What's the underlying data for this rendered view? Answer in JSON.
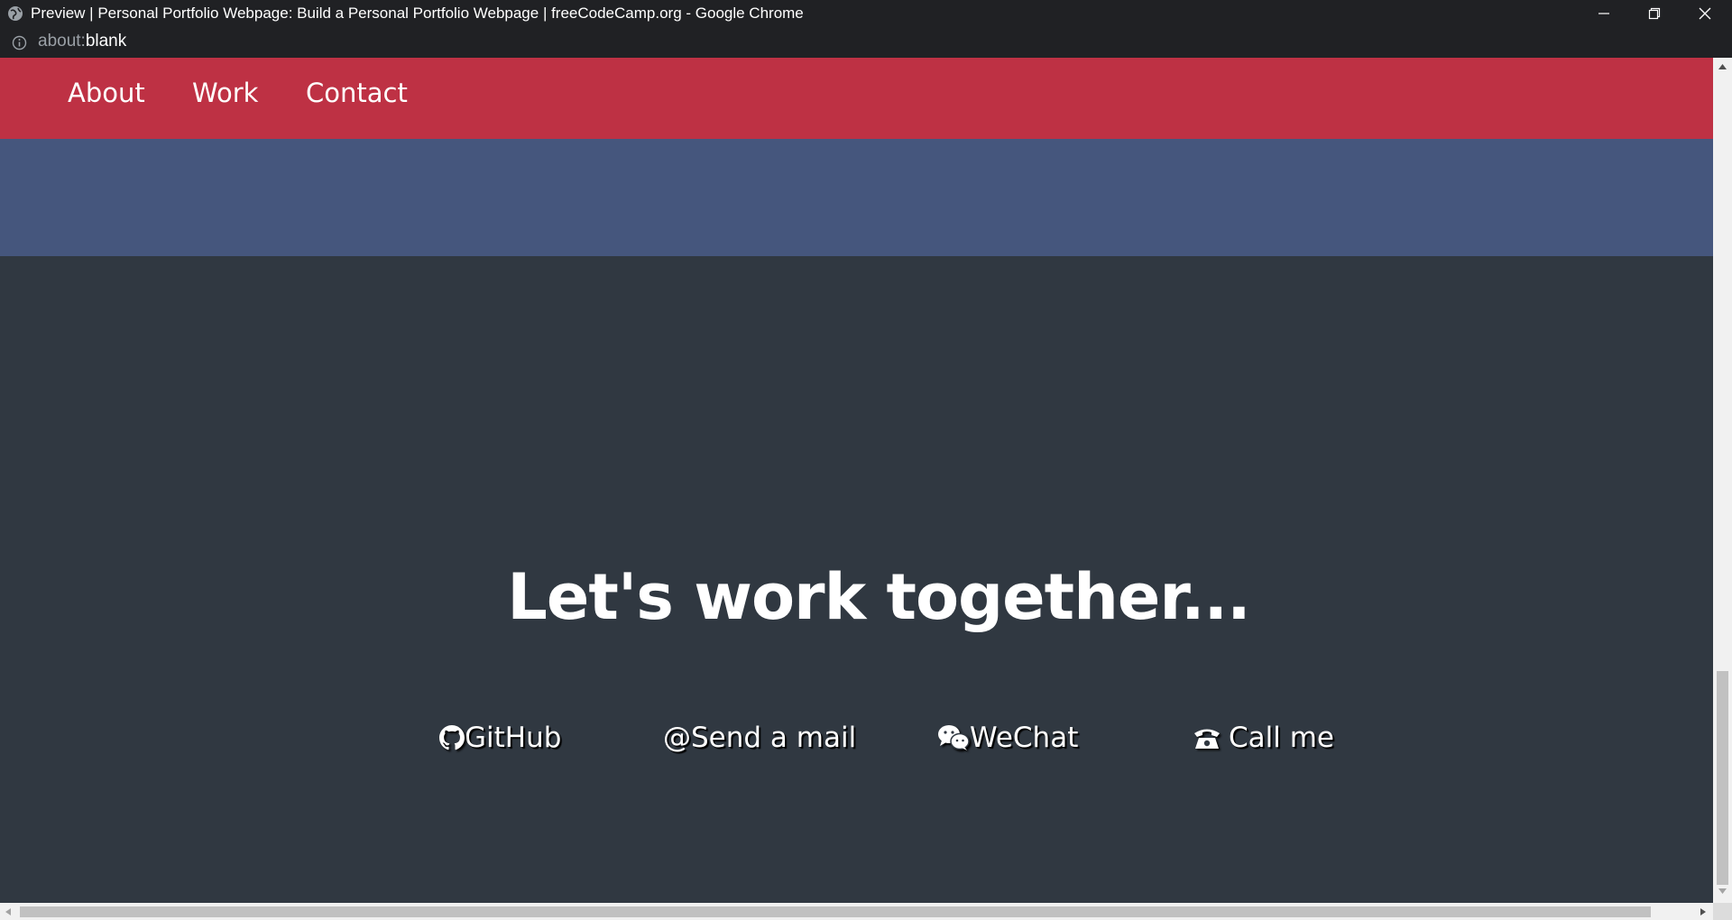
{
  "window": {
    "title": "Preview | Personal Portfolio Webpage: Build a Personal Portfolio Webpage | freeCodeCamp.org - Google Chrome",
    "url_scheme": "about:",
    "url_host": "blank"
  },
  "nav": {
    "items": [
      {
        "label": "About"
      },
      {
        "label": "Work"
      },
      {
        "label": "Contact"
      }
    ]
  },
  "contact": {
    "headline": "Let's work together...",
    "links": [
      {
        "label": "GitHub",
        "icon": "github-icon"
      },
      {
        "label": "Send a mail",
        "icon": "at-icon",
        "prefix": "@"
      },
      {
        "label": "WeChat",
        "icon": "wechat-icon"
      },
      {
        "label": "Call me",
        "icon": "phone-icon"
      }
    ]
  },
  "colors": {
    "navbar": "#be3144",
    "band": "#45567d",
    "background": "#303841",
    "text": "#ffffff"
  }
}
